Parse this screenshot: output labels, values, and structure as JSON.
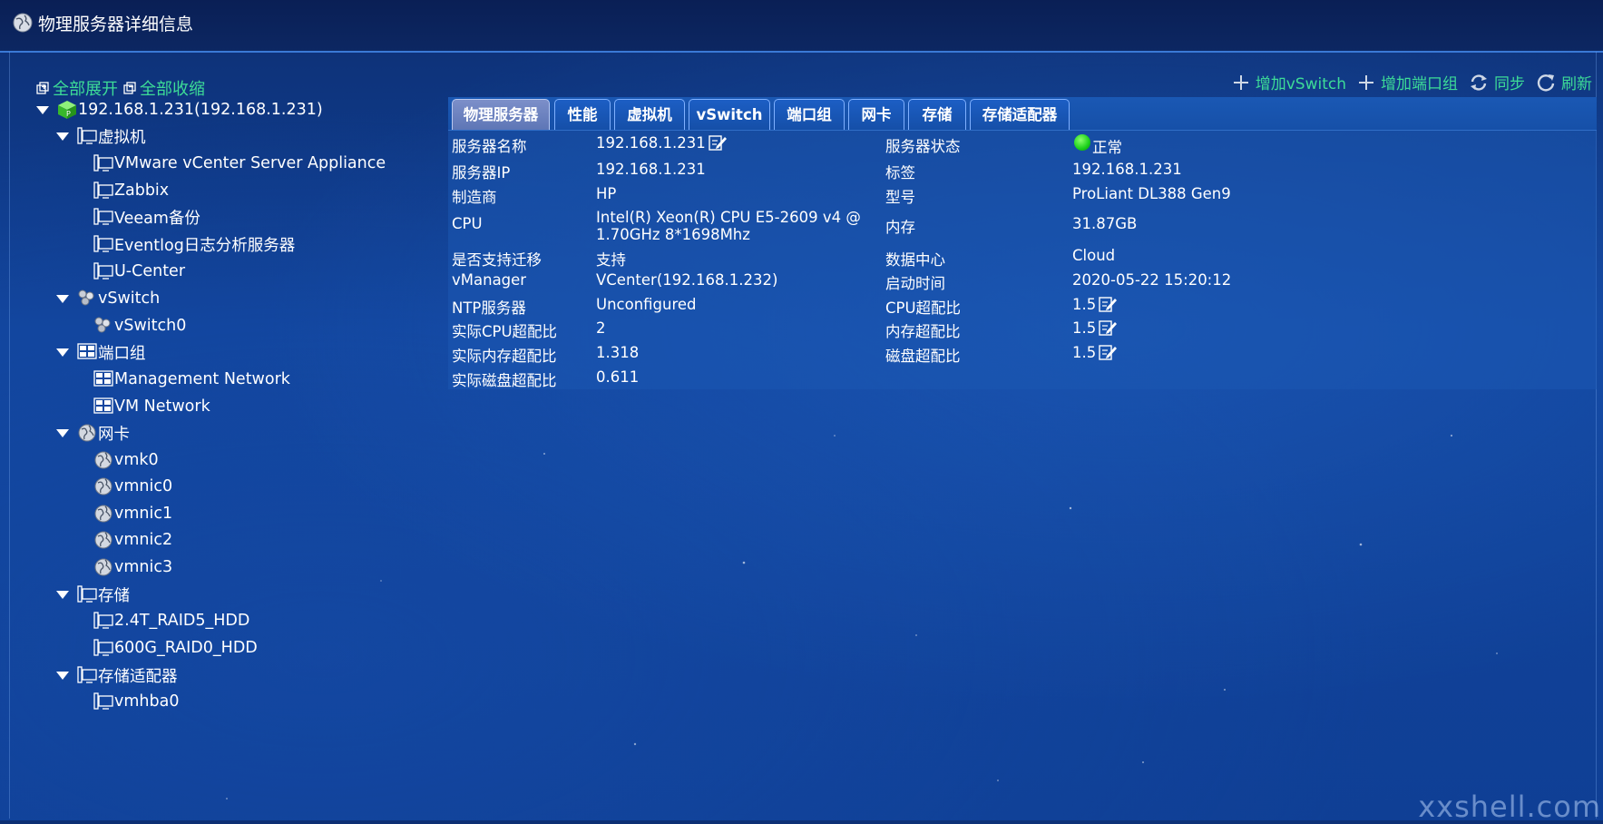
{
  "window": {
    "title": "物理服务器详细信息"
  },
  "tree_controls": {
    "expand_all": "全部展开",
    "collapse_all": "全部收缩"
  },
  "tree": {
    "root": "192.168.1.231(192.168.1.231)",
    "vm_group": "虚拟机",
    "vms": [
      "VMware vCenter Server Appliance",
      "Zabbix",
      "Veeam备份",
      "Eventlog日志分析服务器",
      "U-Center"
    ],
    "vswitch_group": "vSwitch",
    "vswitches": [
      "vSwitch0"
    ],
    "portgroup_group": "端口组",
    "portgroups": [
      "Management Network",
      "VM Network"
    ],
    "nic_group": "网卡",
    "nics": [
      "vmk0",
      "vmnic0",
      "vmnic1",
      "vmnic2",
      "vmnic3"
    ],
    "storage_group": "存储",
    "storages": [
      "2.4T_RAID5_HDD",
      "600G_RAID0_HDD"
    ],
    "adapter_group": "存储适配器",
    "adapters": [
      "vmhba0"
    ]
  },
  "actions": {
    "add_vswitch": "增加vSwitch",
    "add_portgroup": "增加端口组",
    "sync": "同步",
    "refresh": "刷新"
  },
  "tabs": [
    "物理服务器",
    "性能",
    "虚拟机",
    "vSwitch",
    "端口组",
    "网卡",
    "存储",
    "存储适配器"
  ],
  "active_tab": "物理服务器",
  "details": {
    "left": [
      {
        "label": "服务器名称",
        "value": "192.168.1.231"
      },
      {
        "label": "服务器IP",
        "value": "192.168.1.231"
      },
      {
        "label": "制造商",
        "value": "HP"
      },
      {
        "label": "CPU",
        "value": "Intel(R) Xeon(R) CPU E5-2609 v4 @ 1.70GHz 8*1698Mhz"
      },
      {
        "label": "是否支持迁移",
        "value": "支持"
      },
      {
        "label": "vManager",
        "value": "VCenter(192.168.1.232)"
      },
      {
        "label": "NTP服务器",
        "value": "Unconfigured"
      },
      {
        "label": "实际CPU超配比",
        "value": "2"
      },
      {
        "label": "实际内存超配比",
        "value": "1.318"
      },
      {
        "label": "实际磁盘超配比",
        "value": "0.611"
      }
    ],
    "right": [
      {
        "label": "服务器状态",
        "value": "正常"
      },
      {
        "label": "标签",
        "value": "192.168.1.231"
      },
      {
        "label": "型号",
        "value": "ProLiant DL388 Gen9"
      },
      {
        "label": "内存",
        "value": "31.87GB"
      },
      {
        "label": "数据中心",
        "value": "Cloud"
      },
      {
        "label": "启动时间",
        "value": "2020-05-22 15:20:12"
      },
      {
        "label": "CPU超配比",
        "value": "1.5"
      },
      {
        "label": "内存超配比",
        "value": "1.5"
      },
      {
        "label": "磁盘超配比",
        "value": "1.5"
      }
    ]
  },
  "status_color": "#1ad01a",
  "accent_color": "#3ddc97",
  "watermark": "xxshell.com"
}
